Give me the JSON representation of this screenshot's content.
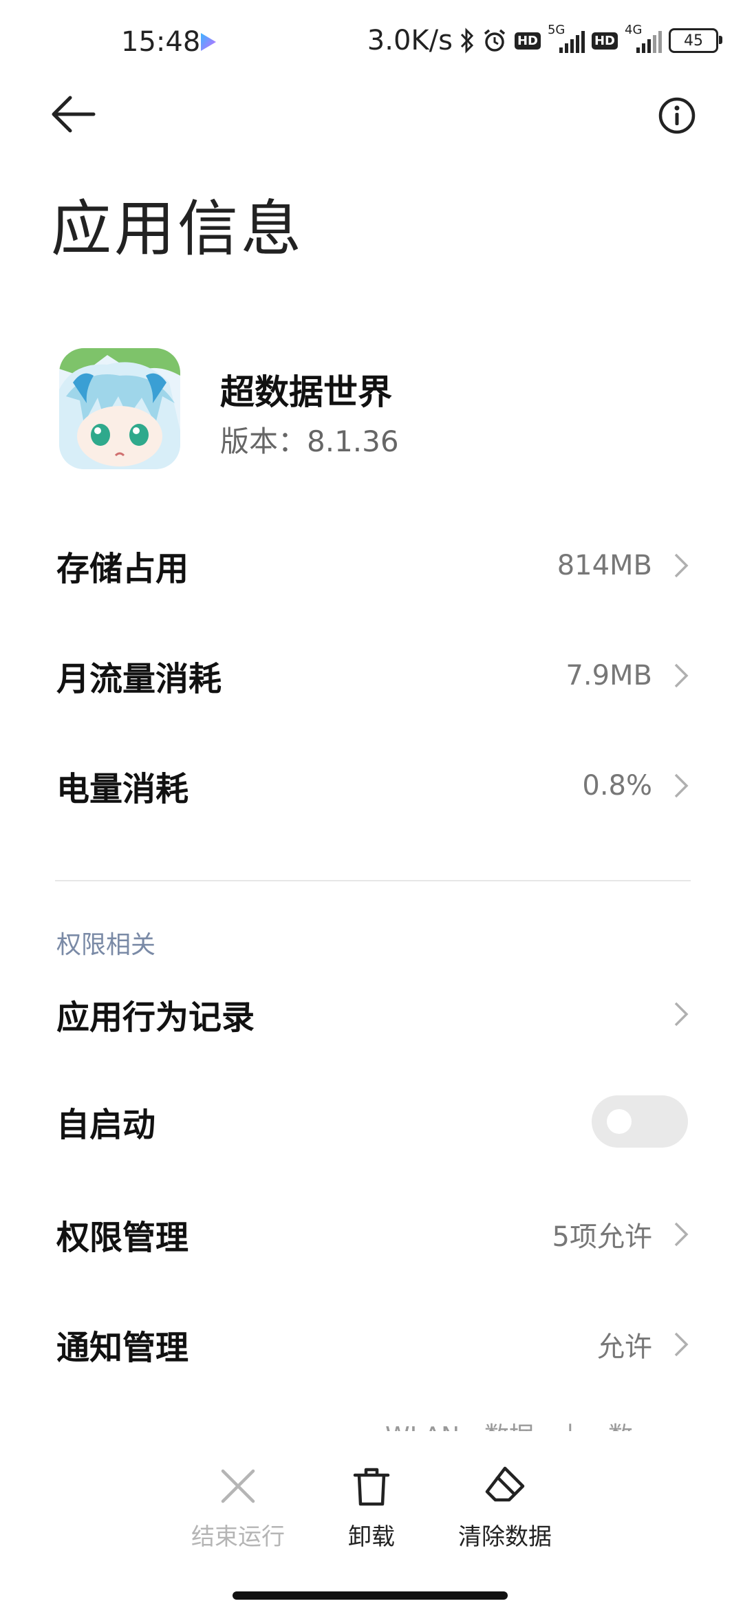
{
  "status_bar": {
    "time": "15:48",
    "net_speed": "3.0K/s",
    "sim1_type": "5G",
    "sim2_type": "4G",
    "hd_label": "HD",
    "battery": "45"
  },
  "header": {
    "title": "应用信息"
  },
  "app": {
    "name": "超数据世界",
    "version": "版本：8.1.36"
  },
  "usage_rows": [
    {
      "label": "存储占用",
      "value": "814MB"
    },
    {
      "label": "月流量消耗",
      "value": "7.9MB"
    },
    {
      "label": "电量消耗",
      "value": "0.8%"
    }
  ],
  "permissions": {
    "section_title": "权限相关",
    "behavior_record": "应用行为记录",
    "autostart": {
      "label": "自启动",
      "enabled": false
    },
    "permission_manage": {
      "label": "权限管理",
      "value": "5项允许"
    },
    "notification_manage": {
      "label": "通知管理",
      "value": "允许"
    }
  },
  "partial_text": "WLAN、数据、上、数",
  "bottom_actions": [
    {
      "label": "结束运行",
      "icon": "close-icon",
      "enabled": false
    },
    {
      "label": "卸载",
      "icon": "trash-icon",
      "enabled": true
    },
    {
      "label": "清除数据",
      "icon": "eraser-icon",
      "enabled": true
    }
  ],
  "colors": {
    "disabled_text": "#b5b5b5",
    "section_title": "#7a8aa6",
    "toggle_off": "#e9e9e9"
  }
}
